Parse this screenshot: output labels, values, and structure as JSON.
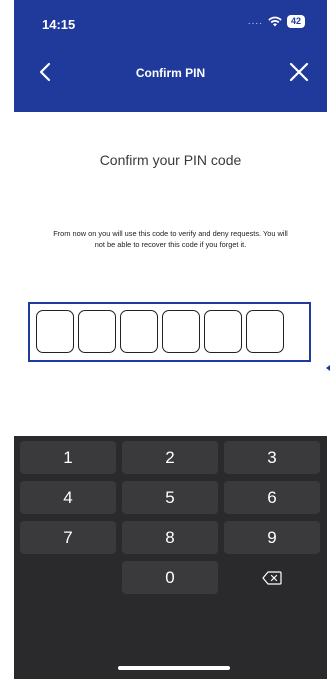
{
  "status_bar": {
    "time": "14:15",
    "signal_text": "....",
    "battery": "42"
  },
  "nav": {
    "title": "Confirm PIN"
  },
  "content": {
    "heading": "Confirm your PIN code",
    "description": "From now on you will use this code to verify and deny requests. You will not be able to recover this code if you forget it."
  },
  "pin": {
    "length": 6,
    "entered": [
      "",
      "",
      "",
      "",
      "",
      ""
    ]
  },
  "keypad": {
    "rows": [
      [
        "1",
        "2",
        "3"
      ],
      [
        "4",
        "5",
        "6"
      ],
      [
        "7",
        "8",
        "9"
      ],
      [
        "",
        "0",
        "backspace"
      ]
    ]
  },
  "colors": {
    "brand_blue": "#1f3a9a",
    "keypad_bg": "#2a2a2c",
    "key_bg": "#3a3a3c"
  },
  "icons": {
    "back": "chevron-left-icon",
    "close": "close-icon",
    "wifi": "wifi-icon",
    "backspace": "backspace-icon"
  }
}
